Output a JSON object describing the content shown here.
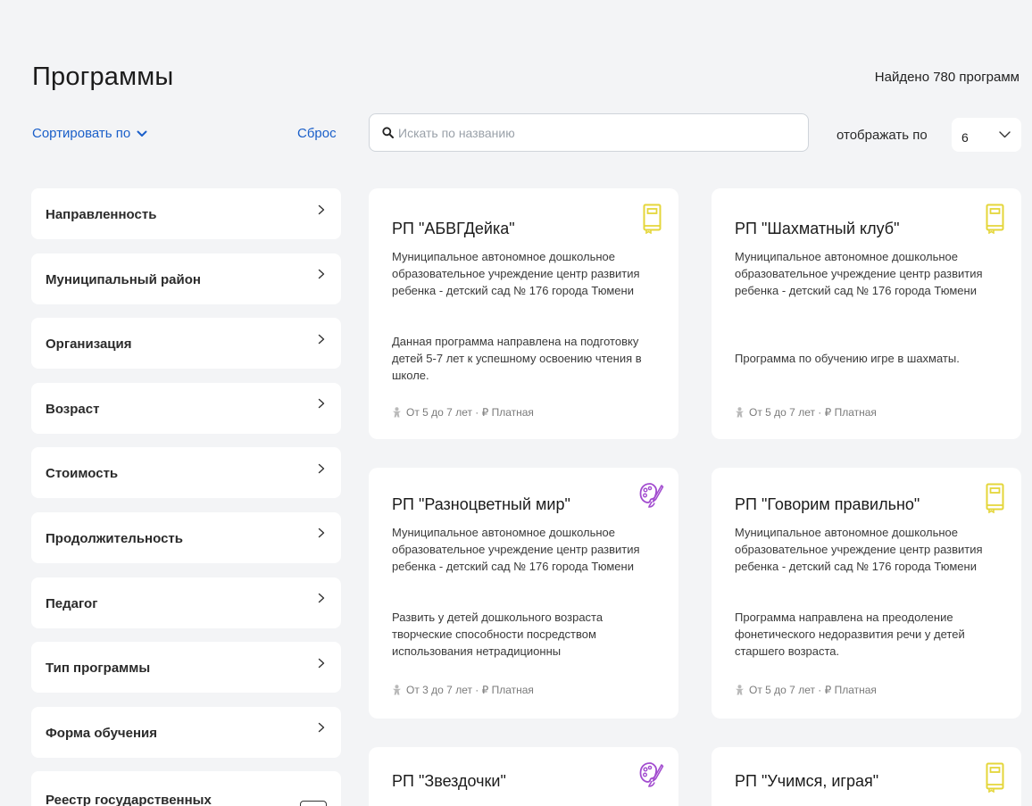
{
  "header": {
    "title": "Программы",
    "found": "Найдено 780 программ"
  },
  "toolbar": {
    "sort_label": "Сортировать по",
    "reset_label": "Сброс",
    "search_placeholder": "Искать по названию",
    "perpage_label": "отображать по",
    "perpage_value": "6"
  },
  "filters": [
    {
      "label": "Направленность"
    },
    {
      "label": "Муниципальный район"
    },
    {
      "label": "Организация"
    },
    {
      "label": "Возраст"
    },
    {
      "label": "Стоимость"
    },
    {
      "label": "Продолжительность"
    },
    {
      "label": "Педагог"
    },
    {
      "label": "Тип программы"
    },
    {
      "label": "Форма обучения"
    },
    {
      "label": "Реестр государственных"
    }
  ],
  "programs": [
    {
      "title": "РП \"АБВГДейка\"",
      "icon": "book-icon",
      "org": "Муниципальное автономное дошкольное образовательное учреждение центр развития ребенка - детский сад № 176 города Тюмени",
      "desc": "Данная программа направлена на подготовку детей 5-7 лет к успешному освоению чтения в школе.",
      "meta": "От 5 до 7 лет · ₽ Платная"
    },
    {
      "title": "РП \"Шахматный клуб\"",
      "icon": "book-icon",
      "org": "Муниципальное автономное дошкольное образовательное учреждение центр развития ребенка - детский сад № 176 города Тюмени",
      "desc": "Программа по обучению игре в шахматы.",
      "meta": "От 5 до 7 лет · ₽ Платная"
    },
    {
      "title": "РП \"Разноцветный мир\"",
      "icon": "palette-icon",
      "org": "Муниципальное автономное дошкольное образовательное учреждение центр развития ребенка - детский сад № 176 города Тюмени",
      "desc": "Развить у детей дошкольного возраста творческие способности посредством использования нетрадиционны",
      "meta": "От 3 до 7 лет · ₽ Платная"
    },
    {
      "title": "РП \"Говорим правильно\"",
      "icon": "book-icon",
      "org": "Муниципальное автономное дошкольное образовательное учреждение центр развития ребенка - детский сад № 176 города Тюмени",
      "desc": "Программа направлена на преодоление фонетического недоразвития речи у детей старшего возраста.",
      "meta": "От 5 до 7 лет · ₽ Платная"
    },
    {
      "title": "РП \"Звездочки\"",
      "icon": "palette-icon"
    },
    {
      "title": "РП \"Учимся, играя\"",
      "icon": "book-icon"
    }
  ],
  "colors": {
    "link": "#1a5fc9",
    "book_icon": "#e4d63a",
    "palette_icon": "#a24ccf"
  }
}
